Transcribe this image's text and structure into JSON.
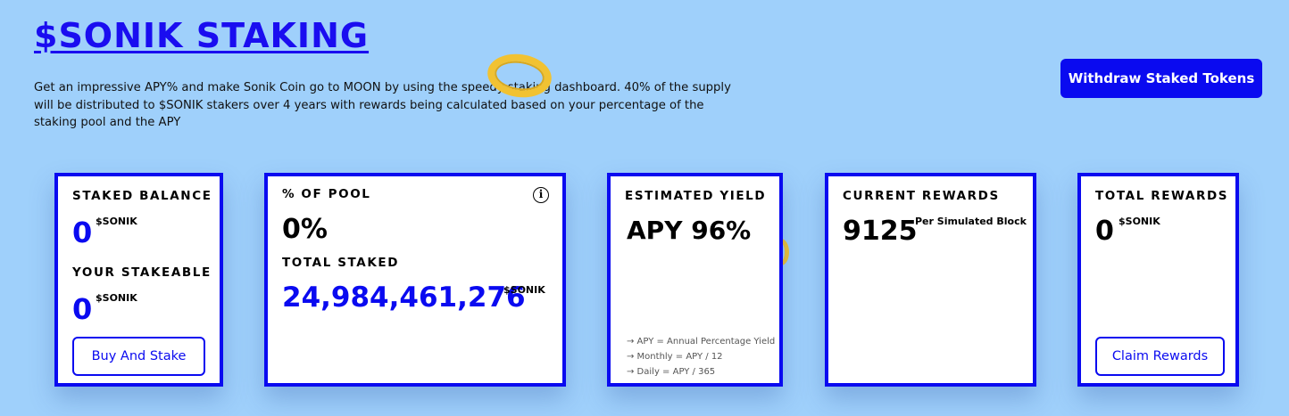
{
  "header": {
    "title": "$SONIK STAKING",
    "description": "Get an impressive APY% and make Sonik Coin go to MOON by using the speedy staking dashboard. 40% of the supply will be distributed to $SONIK stakers over 4 years with rewards being calculated based on your percentage of the staking pool and the APY",
    "withdraw_label": "Withdraw Staked Tokens"
  },
  "cards": {
    "staked": {
      "balance_label": "STAKED BALANCE",
      "balance_value": "0",
      "balance_unit": "$SONIK",
      "stakeable_label": "YOUR STAKEABLE",
      "stakeable_value": "0",
      "stakeable_unit": "$SONIK",
      "button_label": "Buy And Stake"
    },
    "pool": {
      "percent_label": "% OF POOL",
      "percent_value": "0%",
      "total_label": "TOTAL STAKED",
      "total_value": "24,984,461,276",
      "total_unit": "$SONIK",
      "info_icon": "info-icon"
    },
    "yield": {
      "label": "ESTIMATED YIELD",
      "value": "APY 96%",
      "notes": [
        "→ APY = Annual Percentage Yield",
        "→ Monthly = APY / 12",
        "→ Daily = APY / 365"
      ]
    },
    "current": {
      "label": "CURRENT REWARDS",
      "value": "9125",
      "unit": "Per Simulated Block"
    },
    "total": {
      "label": "TOTAL REWARDS",
      "value": "0",
      "unit": "$SONIK",
      "button_label": "Claim Rewards"
    }
  },
  "colors": {
    "background": "#9fd0fb",
    "accent": "#0a0af0",
    "ring": "#f1c232"
  }
}
